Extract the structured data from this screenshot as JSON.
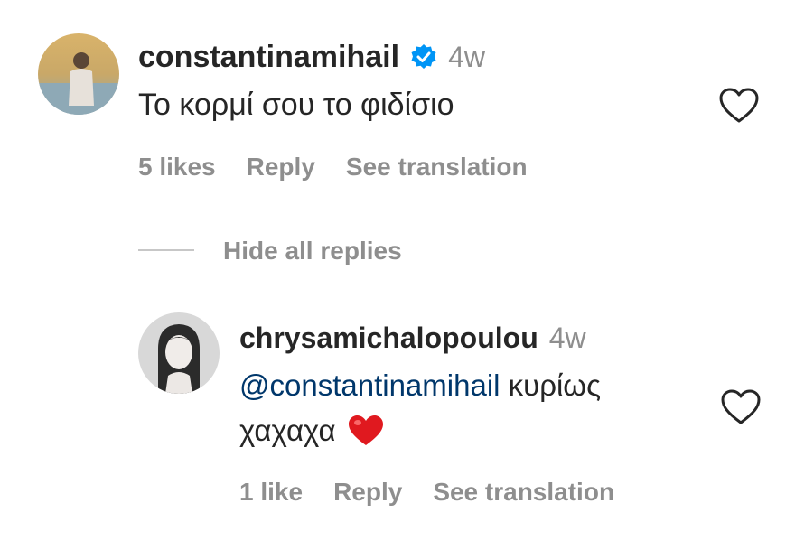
{
  "comment": {
    "username": "constantinamihail",
    "verified": true,
    "time": "4w",
    "text": "Το κορμί σου το φιδίσιο",
    "likes": "5 likes",
    "reply_label": "Reply",
    "translate_label": "See translation",
    "avatar_icon": "profile-photo-beach",
    "like_icon": "heart-outline-icon"
  },
  "toggle_replies": {
    "label": "Hide all replies"
  },
  "reply": {
    "username": "chrysamichalopoulou",
    "time": "4w",
    "mention": "@constantinamihail",
    "text_after_mention": "κυρίως",
    "text_line2": "χαχαχα",
    "emoji": "red-heart-emoji",
    "likes": "1 like",
    "reply_label": "Reply",
    "translate_label": "See translation",
    "avatar_icon": "profile-photo-portrait",
    "like_icon": "heart-outline-icon"
  },
  "colors": {
    "text": "#262626",
    "secondary": "#8e8e8e",
    "mention": "#00376b",
    "verified": "#0095f6",
    "heart_emoji": "#e0191f"
  }
}
